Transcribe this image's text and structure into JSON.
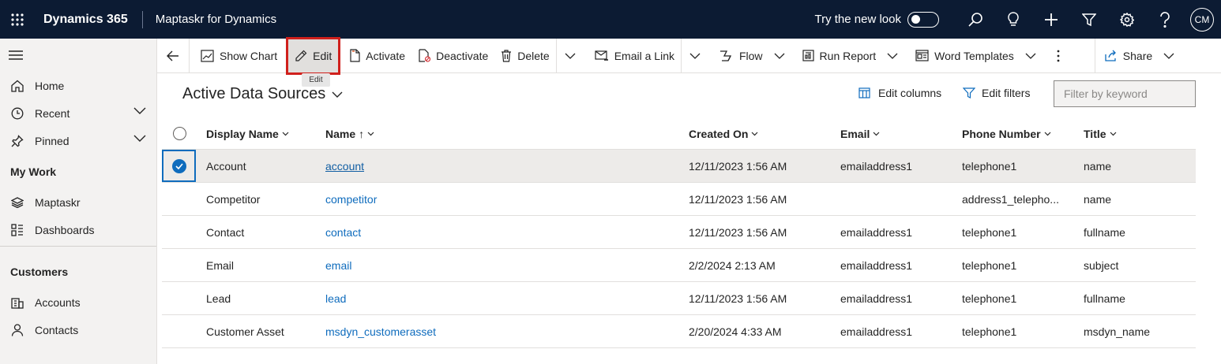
{
  "topbar": {
    "brand": "Dynamics 365",
    "app_name": "Maptaskr for Dynamics",
    "try_new_look": "Try the new look",
    "avatar_initials": "CM",
    "bg_color": "#0c1b33"
  },
  "sidebar": {
    "items": [
      {
        "label": "Home",
        "icon": "home-icon"
      },
      {
        "label": "Recent",
        "icon": "clock-icon"
      },
      {
        "label": "Pinned",
        "icon": "pin-icon"
      }
    ],
    "my_work_label": "My Work",
    "my_work_items": [
      {
        "label": "Maptaskr",
        "icon": "layers-icon"
      },
      {
        "label": "Dashboards",
        "icon": "dashboard-icon"
      }
    ],
    "customers_label": "Customers",
    "customers_items": [
      {
        "label": "Accounts",
        "icon": "building-icon"
      },
      {
        "label": "Contacts",
        "icon": "person-icon"
      }
    ]
  },
  "commandbar": {
    "show_chart": "Show Chart",
    "edit": "Edit",
    "edit_tooltip": "Edit",
    "activate": "Activate",
    "deactivate": "Deactivate",
    "delete": "Delete",
    "email_link": "Email a Link",
    "flow": "Flow",
    "run_report": "Run Report",
    "word_templates": "Word Templates",
    "share": "Share"
  },
  "view": {
    "title": "Active Data Sources",
    "edit_columns": "Edit columns",
    "edit_filters": "Edit filters",
    "filter_placeholder": "Filter by keyword"
  },
  "grid": {
    "columns": [
      "Display Name",
      "Name",
      "Created On",
      "Email",
      "Phone Number",
      "Title"
    ],
    "sort_indicator": "↑",
    "rows": [
      {
        "display_name": "Account",
        "name": "account",
        "created_on": "12/11/2023 1:56 AM",
        "email": "emailaddress1",
        "phone": "telephone1",
        "title": "name",
        "selected": true
      },
      {
        "display_name": "Competitor",
        "name": "competitor",
        "created_on": "12/11/2023 1:56 AM",
        "email": "",
        "phone": "address1_telepho...",
        "title": "name",
        "selected": false
      },
      {
        "display_name": "Contact",
        "name": "contact",
        "created_on": "12/11/2023 1:56 AM",
        "email": "emailaddress1",
        "phone": "telephone1",
        "title": "fullname",
        "selected": false
      },
      {
        "display_name": "Email",
        "name": "email",
        "created_on": "2/2/2024 2:13 AM",
        "email": "emailaddress1",
        "phone": "telephone1",
        "title": "subject",
        "selected": false
      },
      {
        "display_name": "Lead",
        "name": "lead",
        "created_on": "12/11/2023 1:56 AM",
        "email": "emailaddress1",
        "phone": "telephone1",
        "title": "fullname",
        "selected": false
      },
      {
        "display_name": "Customer Asset",
        "name": "msdyn_customerasset",
        "created_on": "2/20/2024 4:33 AM",
        "email": "emailaddress1",
        "phone": "telephone1",
        "title": "msdyn_name",
        "selected": false
      }
    ]
  }
}
